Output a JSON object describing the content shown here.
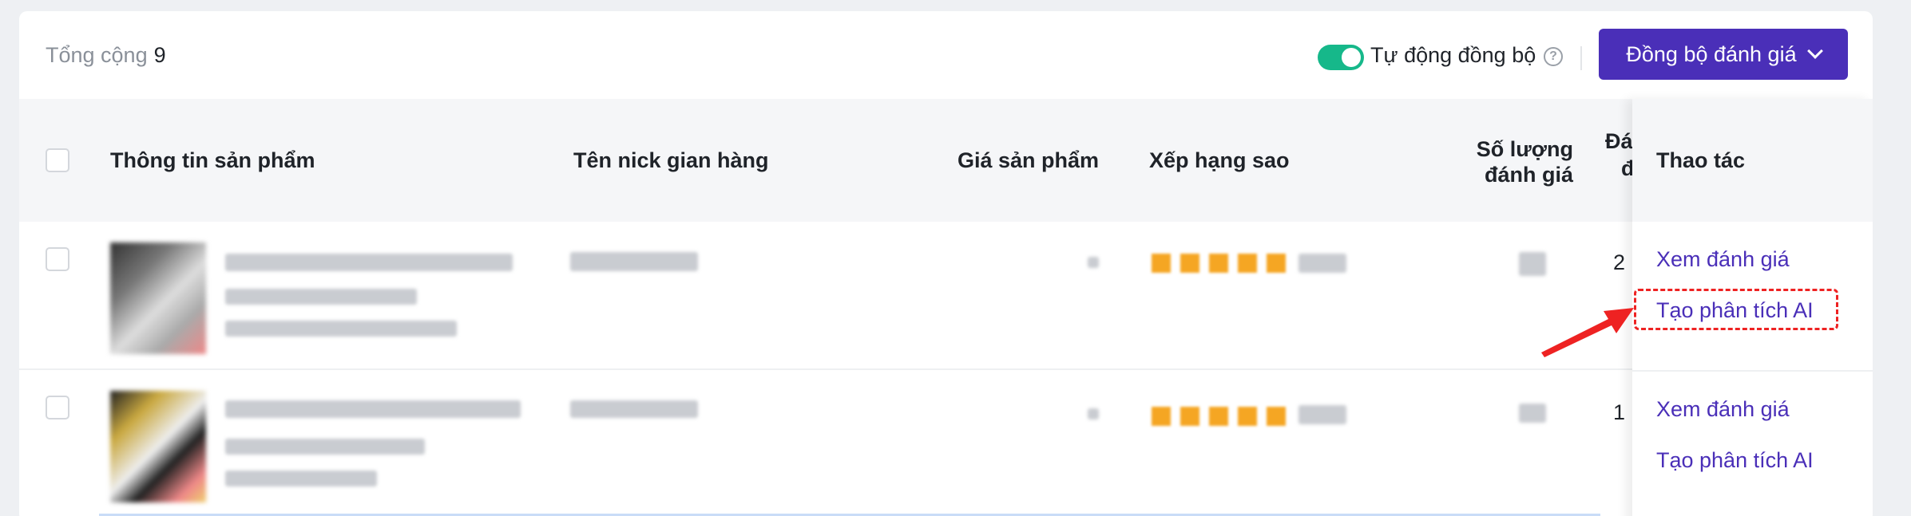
{
  "toolbar": {
    "total_label": "Tổng cộng",
    "total_count": "9",
    "auto_sync_label": "Tự động đồng bộ",
    "help_glyph": "?",
    "sync_button_label": "Đồng bộ đánh giá",
    "toggle_on": true,
    "accent_color": "#4a2fb8",
    "toggle_color": "#16b88a"
  },
  "table": {
    "headers": {
      "product_info": "Thông tin sản phẩm",
      "shop_nick": "Tên nick gian hàng",
      "price": "Giá sản phẩm",
      "rating": "Xếp hạng sao",
      "review_count_line1": "Số lượng",
      "review_count_line2": "đánh giá",
      "partial_line1": "Đá",
      "partial_line2": "đ",
      "actions": "Thao tác"
    },
    "rows": [
      {
        "view_reviews": "Xem đánh giá",
        "create_ai": "Tạo phân tích AI",
        "partial_value": "2"
      },
      {
        "view_reviews": "Xem đánh giá",
        "create_ai": "Tạo phân tích AI",
        "partial_value": "1"
      }
    ]
  },
  "annotation": {
    "color": "#ee2222"
  }
}
